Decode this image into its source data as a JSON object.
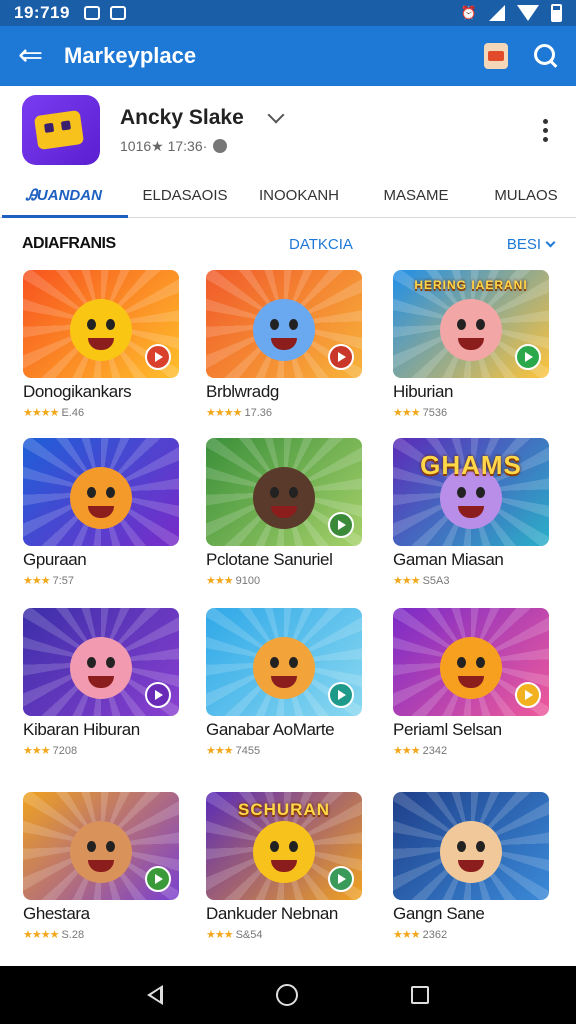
{
  "status_bar": {
    "time": "19:719",
    "icons": [
      "mail-icon",
      "notification-icon",
      "alarm-icon",
      "signal-icon",
      "wifi-icon",
      "battery-icon"
    ]
  },
  "app_bar": {
    "title": "Markeyplace",
    "back_icon": "back-arrow-icon",
    "actions": [
      "shopping-bag-icon",
      "search-icon"
    ]
  },
  "app_header": {
    "name": "Ancky Slake",
    "meta": "1016★ 17:36·"
  },
  "tabs": [
    {
      "label": "ᎯUANDAN",
      "active": true
    },
    {
      "label": "ELDASAOIS",
      "active": false
    },
    {
      "label": "INOOKANH",
      "active": false
    },
    {
      "label": "MASAME",
      "active": false
    },
    {
      "label": "MULAOS",
      "active": false
    }
  ],
  "section": {
    "title": "ADIAFRANIS",
    "link": "DATKCIA",
    "sort_label": "BESI"
  },
  "games": [
    {
      "title": "Donogikankars",
      "stars": "★★★★",
      "rating": "E.46",
      "color_a": "#f7531f",
      "color_b": "#ffbf2b",
      "char": "#f9c614",
      "badge": "#d9412c",
      "banner": ""
    },
    {
      "title": "Brblwradg",
      "stars": "★★★★",
      "rating": "17.36",
      "color_a": "#f15a2a",
      "color_b": "#f7b33a",
      "char": "#6aa8f0",
      "badge": "#c8372a",
      "banner": ""
    },
    {
      "title": "Hiburian",
      "stars": "★★★",
      "rating": "7536",
      "color_a": "#1f8ee8",
      "color_b": "#ffc43a",
      "char": "#f2a6a6",
      "badge": "#2aa84a",
      "banner": "HERING IAERANI"
    },
    {
      "title": "Gpuraan",
      "stars": "★★★",
      "rating": "7:57",
      "color_a": "#1d5fd8",
      "color_b": "#7a2bc8",
      "char": "#f39a2b",
      "badge": "",
      "banner": ""
    },
    {
      "title": "Pclotane Sanuriel",
      "stars": "★★★",
      "rating": "9100",
      "color_a": "#3a8f3a",
      "color_b": "#a6d16a",
      "char": "#5a3a2a",
      "badge": "#3a8a3a",
      "banner": ""
    },
    {
      "title": "Gaman Miasan",
      "stars": "★★★",
      "rating": "S5A3",
      "color_a": "#5b2bb8",
      "color_b": "#2ab0c8",
      "char": "#b98ee8",
      "badge": "",
      "banner": "GHAMS"
    },
    {
      "title": "Kibaran Hiburan",
      "stars": "★★★",
      "rating": "7208",
      "color_a": "#3b2fa8",
      "color_b": "#8a3fd0",
      "char": "#f29ab0",
      "badge": "#6a2ab8",
      "banner": ""
    },
    {
      "title": "Ganabar AoMarte",
      "stars": "★★★",
      "rating": "7455",
      "color_a": "#2fa8e8",
      "color_b": "#8ad8f0",
      "char": "#f2a43a",
      "badge": "#1f9a8a",
      "banner": ""
    },
    {
      "title": "Periaml Selsan",
      "stars": "★★★",
      "rating": "2342",
      "color_a": "#7a2bc8",
      "color_b": "#ef5a9a",
      "char": "#f7a01f",
      "badge": "#f2b21f",
      "banner": ""
    },
    {
      "title": "Ghestara",
      "stars": "★★★★",
      "rating": "S.28",
      "color_a": "#f0a21f",
      "color_b": "#7a3fd0",
      "char": "#d8925a",
      "badge": "#3a9a3a",
      "banner": ""
    },
    {
      "title": "Dankuder Nebnan",
      "stars": "★★★",
      "rating": "S&54",
      "color_a": "#5a2bb8",
      "color_b": "#f2a21f",
      "char": "#f7c21b",
      "badge": "#3a9a5a",
      "banner": "SCHURAN"
    },
    {
      "title": "Gangn Sane",
      "stars": "★★★",
      "rating": "2362",
      "color_a": "#1f3f8a",
      "color_b": "#3a8ad8",
      "char": "#f0c89a",
      "badge": "",
      "banner": ""
    }
  ],
  "nav_bar": [
    "nav-back-icon",
    "nav-home-icon",
    "nav-recents-icon"
  ]
}
